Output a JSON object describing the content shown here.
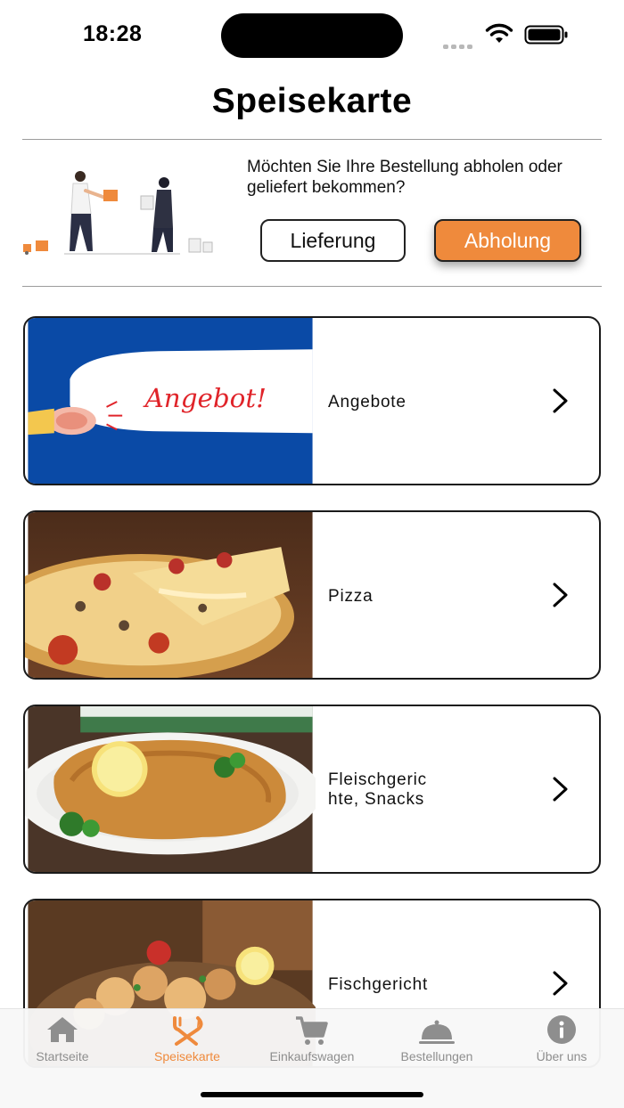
{
  "status_bar": {
    "time": "18:28"
  },
  "header": {
    "title": "Speisekarte"
  },
  "order_choice": {
    "question": "Möchten Sie Ihre Bestellung abholen oder geliefert bekommen?",
    "delivery_label": "Lieferung",
    "pickup_label": "Abholung",
    "selected": "Abholung",
    "accent_color": "#ef8a3c"
  },
  "categories": [
    {
      "label": "Angebote",
      "image_text": "Angebot!",
      "icon": "chevron-right-icon"
    },
    {
      "label": "Pizza",
      "icon": "chevron-right-icon"
    },
    {
      "label": "Fleischgeric hte, Snacks",
      "icon": "chevron-right-icon"
    },
    {
      "label": "Fischgericht",
      "icon": "chevron-right-icon"
    }
  ],
  "tab_bar": {
    "active": "Speisekarte",
    "tabs": [
      {
        "label": "Startseite",
        "icon": "home-icon"
      },
      {
        "label": "Speisekarte",
        "icon": "fork-knife-icon"
      },
      {
        "label": "Einkaufswagen",
        "icon": "cart-icon"
      },
      {
        "label": "Bestellungen",
        "icon": "cloche-icon"
      },
      {
        "label": "Über uns",
        "icon": "info-icon"
      }
    ]
  }
}
